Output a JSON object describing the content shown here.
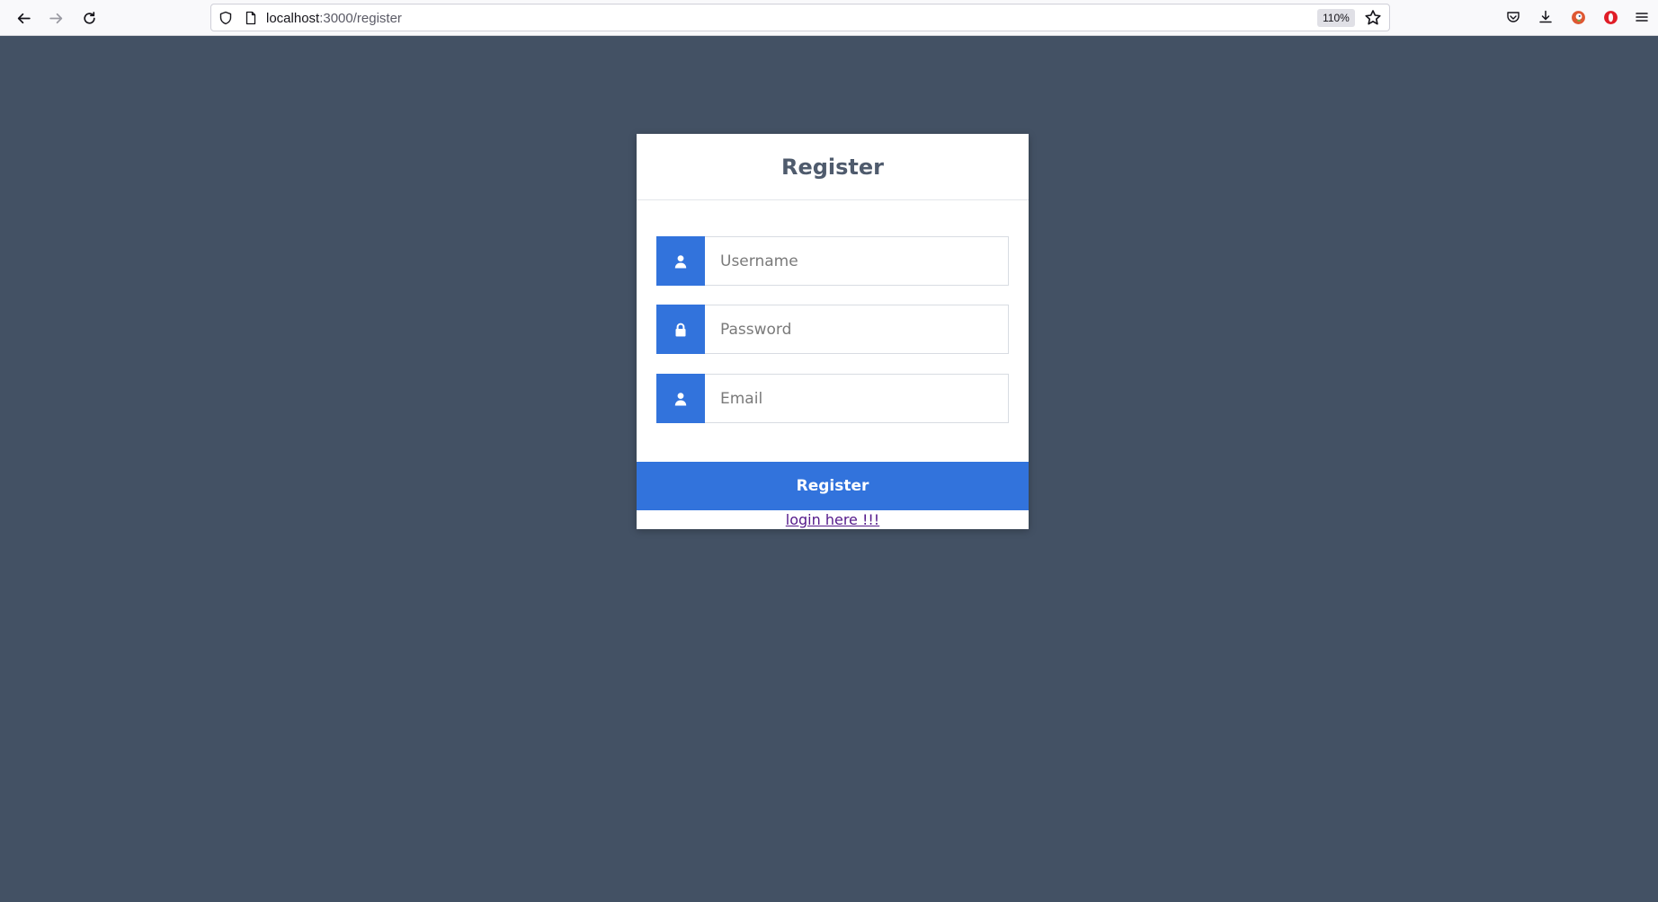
{
  "browser": {
    "url_host": "localhost",
    "url_rest": ":3000/register",
    "zoom": "110%",
    "icons": {
      "back": "back-arrow-icon",
      "forward": "forward-arrow-icon",
      "reload": "reload-icon",
      "shield": "tracking-shield-icon",
      "page": "page-icon",
      "star": "bookmark-star-icon",
      "pocket": "pocket-icon",
      "downloads": "download-icon",
      "duckduckgo": "duckduckgo-extension-icon",
      "opera": "opera-extension-icon",
      "menu": "hamburger-menu-icon"
    }
  },
  "page": {
    "background": "#435164",
    "accent": "#3273dc",
    "title": "Register",
    "fields": [
      {
        "placeholder": "Username",
        "icon": "user-icon"
      },
      {
        "placeholder": "Password",
        "icon": "lock-icon"
      },
      {
        "placeholder": "Email",
        "icon": "user-icon"
      }
    ],
    "submit_label": "Register",
    "login_link": "login here !!!"
  }
}
